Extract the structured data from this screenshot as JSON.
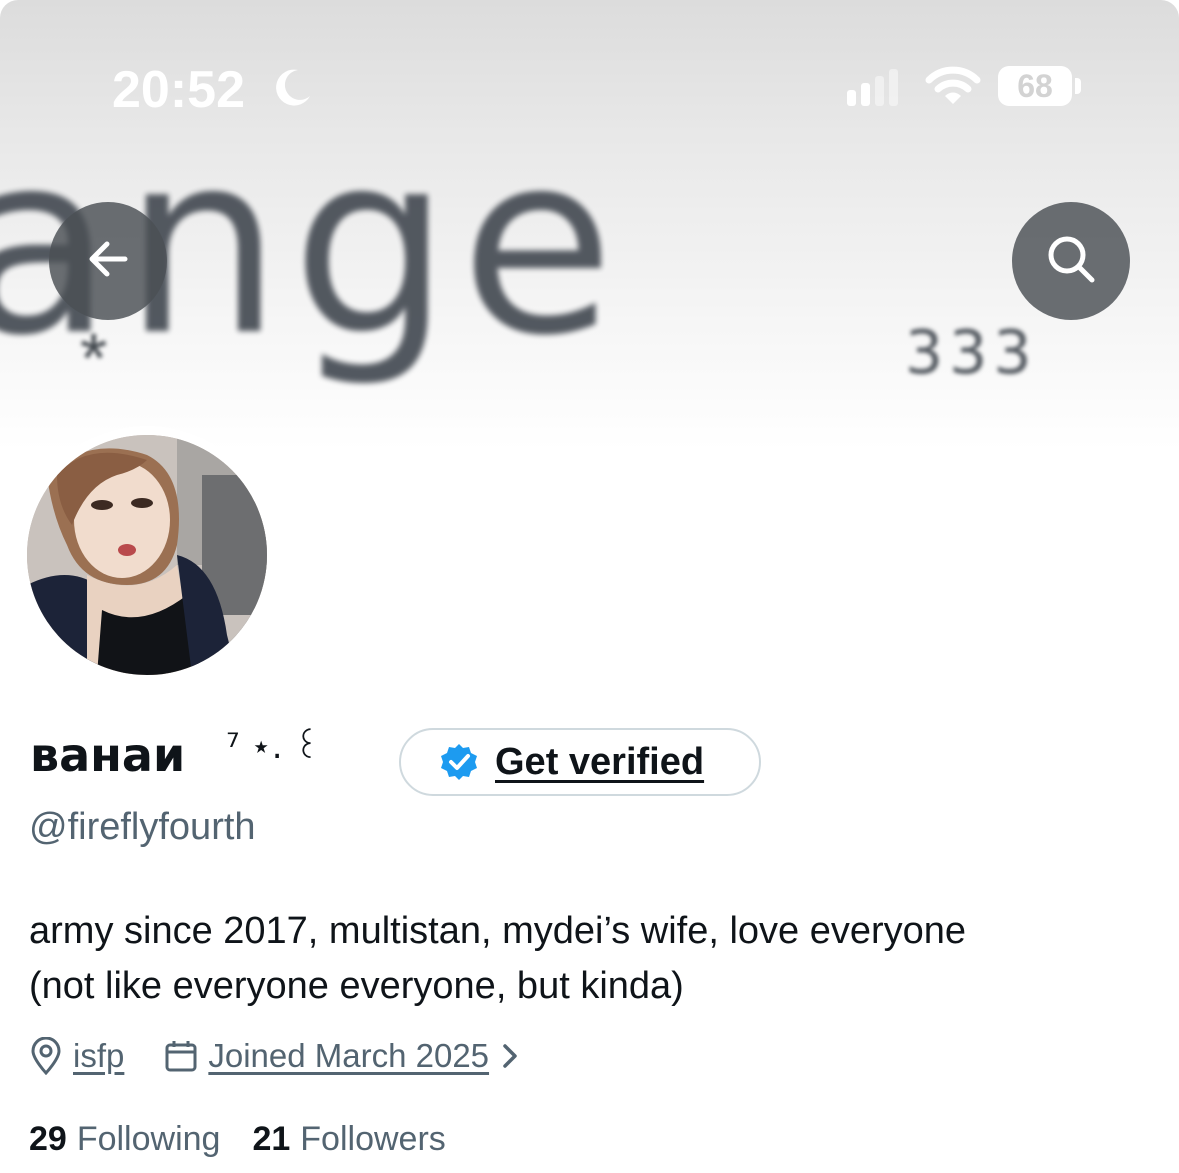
{
  "status_bar": {
    "time": "20:52",
    "battery": "68"
  },
  "header": {
    "banner_text": "ange",
    "banner_star": "*",
    "banner_number": "333"
  },
  "profile": {
    "display_name": "ванаи",
    "name_decoration": "⁷ ⋆. ꒰",
    "verify_label": "Get verified",
    "handle": "@fireflyfourth",
    "bio_line1": "army since 2017, multistan, mydei’s wife, love everyone",
    "bio_line2": "(not like everyone everyone, but kinda)",
    "location": "isfp",
    "joined": "Joined March 2025",
    "following_count": "29",
    "following_label": "Following",
    "followers_count": "21",
    "followers_label": "Followers"
  },
  "colors": {
    "text_primary": "#0f1419",
    "text_secondary": "#536471",
    "verified_blue": "#1d9bf0",
    "pill_border": "#cfd9de"
  },
  "icons": [
    "moon-icon",
    "signal-icon",
    "wifi-icon",
    "battery-icon",
    "back-arrow-icon",
    "search-icon",
    "verified-badge-icon",
    "location-icon",
    "calendar-icon",
    "chevron-right-icon"
  ]
}
